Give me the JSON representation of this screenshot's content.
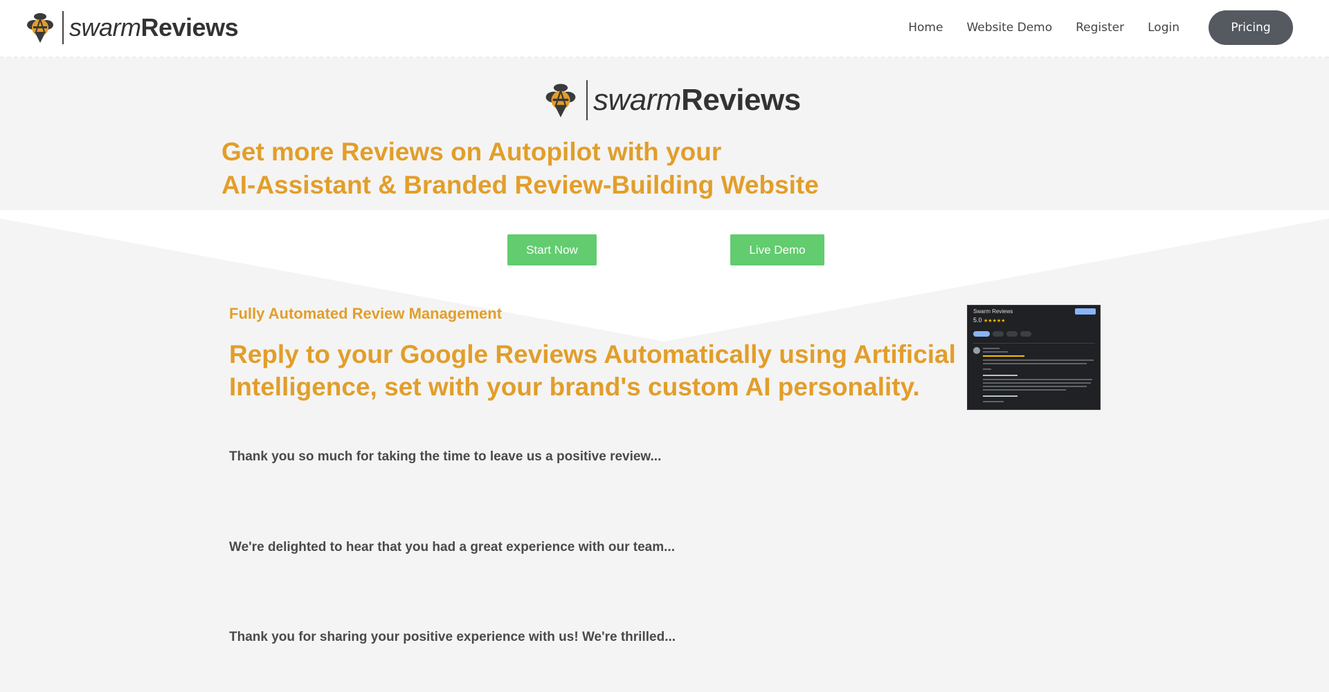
{
  "brand": {
    "name_light": "swarm",
    "name_bold": "Reviews"
  },
  "nav": {
    "items": [
      {
        "label": "Home"
      },
      {
        "label": "Website Demo"
      },
      {
        "label": "Register"
      },
      {
        "label": "Login"
      }
    ],
    "pricing_label": "Pricing"
  },
  "hero": {
    "headline_line1": "Get more Reviews on Autopilot with your",
    "headline_line2": "AI-Assistant & Branded Review-Building Website",
    "start_label": "Start Now",
    "demo_label": "Live Demo"
  },
  "feature": {
    "subheading": "Fully Automated Review Management",
    "heading": "Reply to your Google Reviews Automatically using Artificial Intelligence, set with your brand's custom AI personality.",
    "quotes": [
      "Thank you so much for taking the time to leave us a positive review...",
      "We're delighted to hear that you had a great experience with our team...",
      "Thank you for sharing your positive experience with us! We're thrilled..."
    ]
  },
  "screenshot": {
    "title": "Swarm Reviews",
    "rating": "5.0",
    "stars": "★★★★★"
  },
  "colors": {
    "accent_orange": "#e29e2a",
    "button_green": "#62cc6f",
    "pricing_dark": "#555960",
    "background": "#f4f4f4"
  }
}
